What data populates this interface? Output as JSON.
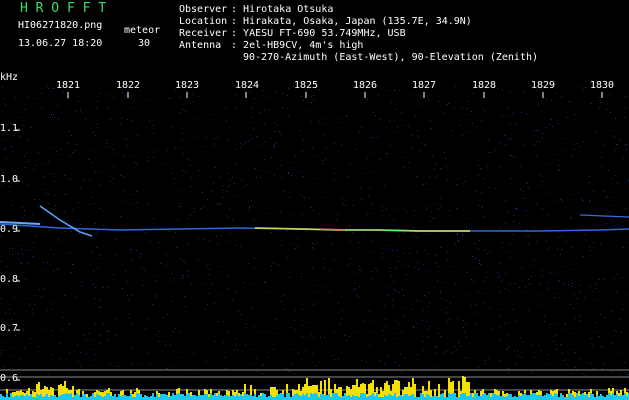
{
  "header": {
    "title": "H R O F F T",
    "filename": "HI06271820.png",
    "datetime": "13.06.27 18:20",
    "meteor_label": "meteor",
    "meteor_count": "30"
  },
  "station": [
    {
      "key": "Observer",
      "value": "Hirotaka Otsuka"
    },
    {
      "key": "Location",
      "value": "Hirakata, Osaka, Japan (135.7E, 34.9N)"
    },
    {
      "key": "Receiver",
      "value": "YAESU FT-690 53.749MHz, USB"
    },
    {
      "key": "Antenna",
      "value": "2el-HB9CV, 4m's high"
    },
    {
      "key": "",
      "value": "90-270-Azimuth (East-West), 90-Elevation (Zenith)"
    }
  ],
  "axis": {
    "unit": "kHz",
    "y_ticks": [
      "1.1",
      "1.0",
      "0.9",
      "0.8",
      "0.7",
      "0.6"
    ],
    "x_ticks": [
      "1821",
      "1822",
      "1823",
      "1824",
      "1825",
      "1826",
      "1827",
      "1828",
      "1829",
      "1830"
    ]
  },
  "colors": {
    "title": "#2fe06a",
    "background": "#000000",
    "noise": "#1a2a80",
    "trace": "#3a78ff",
    "bar_yellow": "#f5e000",
    "bar_cyan": "#19c8f0"
  }
}
